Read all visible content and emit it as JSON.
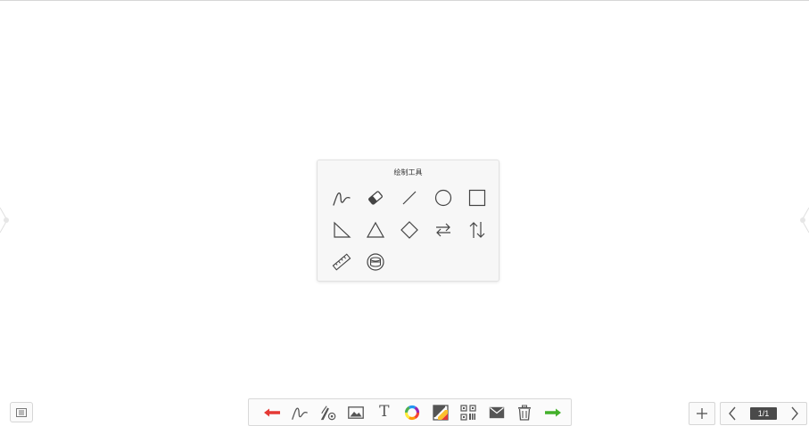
{
  "tool_panel": {
    "title": "绘制工具",
    "tools": [
      {
        "name": "freehand-pen",
        "icon": "pen-curve-icon"
      },
      {
        "name": "eraser",
        "icon": "eraser-icon"
      },
      {
        "name": "line",
        "icon": "line-icon"
      },
      {
        "name": "circle",
        "icon": "circle-icon"
      },
      {
        "name": "rectangle",
        "icon": "square-icon"
      },
      {
        "name": "right-triangle",
        "icon": "right-triangle-icon"
      },
      {
        "name": "triangle",
        "icon": "triangle-icon"
      },
      {
        "name": "diamond",
        "icon": "diamond-icon"
      },
      {
        "name": "bidirectional-arrows",
        "icon": "swap-arrows-icon"
      },
      {
        "name": "vertical-arrows",
        "icon": "vertical-arrows-icon"
      },
      {
        "name": "ruler",
        "icon": "ruler-icon"
      },
      {
        "name": "cylinder",
        "icon": "cylinder-icon"
      }
    ]
  },
  "toolbar": {
    "items": [
      {
        "name": "undo",
        "icon": "undo-arrow-icon",
        "color": "#e53935"
      },
      {
        "name": "pen",
        "icon": "pen-curve-icon"
      },
      {
        "name": "pen-settings",
        "icon": "pen-settings-icon"
      },
      {
        "name": "image",
        "icon": "image-icon"
      },
      {
        "name": "text",
        "icon": "text-icon",
        "label": "T"
      },
      {
        "name": "color",
        "icon": "color-wheel-icon"
      },
      {
        "name": "background",
        "icon": "background-icon"
      },
      {
        "name": "qr-code",
        "icon": "qr-code-icon"
      },
      {
        "name": "mail",
        "icon": "mail-icon"
      },
      {
        "name": "delete",
        "icon": "trash-icon"
      },
      {
        "name": "redo",
        "icon": "redo-arrow-icon",
        "color": "#43b02a"
      }
    ]
  },
  "pager": {
    "add_label": "+",
    "current": "1/1"
  }
}
